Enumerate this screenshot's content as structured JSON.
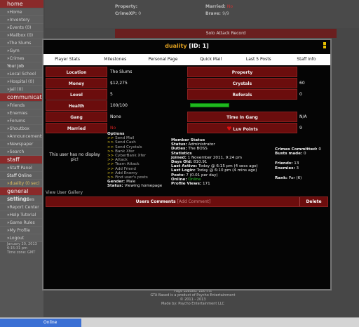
{
  "sidebar": {
    "sections": [
      {
        "head": "home",
        "items": [
          "»Home",
          "»Inventory",
          "»Events (0)",
          "»Mailbox (0)",
          "»The Slums",
          "»Gym",
          "»Crimes",
          "Your Job",
          "»Local School",
          "»Hospital (0)",
          "»Jail (0)"
        ]
      },
      {
        "head": "communicate",
        "items": [
          "»Friends",
          "»Enemies",
          "»Forums",
          "»Shoutbox",
          "»Announcements",
          "»Newspaper",
          "»Search"
        ]
      },
      {
        "head": "staff",
        "items": [
          "»Staff Panel",
          "Staff Online",
          "»duality (0 sec)"
        ]
      },
      {
        "head": "general settings",
        "items": [
          "»Preferences",
          "»Report Center",
          "»Help Tutorial",
          "»Game Rules",
          "»My Profile",
          "»Logout"
        ]
      }
    ],
    "footer": [
      "January 20, 2013",
      "6:15:31 pm",
      "Time zone: GMT"
    ]
  },
  "topinfo": {
    "property_label": "Property:",
    "married_label": "Married:",
    "married_value": "No",
    "crimexp_label": "CrimeXP:",
    "crimexp_value": "0",
    "brave_label": "Brave:",
    "brave_value": "9/9"
  },
  "solo_attack": "Solo Attack Record",
  "modal": {
    "username": "duality",
    "id_text": "[ID: 1]",
    "tabs": [
      "Player Stats",
      "Milestones",
      "Personal Page",
      "Quick Mail",
      "Last 5 Posts",
      "Staff Info"
    ],
    "stats": [
      {
        "l1": "Location",
        "v1": "The Slums",
        "l2": "Property",
        "v2": ""
      },
      {
        "l1": "Money",
        "v1": "$12,275",
        "l2": "Crystals",
        "v2": "60"
      },
      {
        "l1": "Level",
        "v1": "5",
        "l2": "Referals",
        "v2": "0"
      },
      {
        "l1": "Health",
        "v1": "100/100",
        "l2": "",
        "v2": ""
      },
      {
        "l1": "Gang",
        "v1": "None",
        "l2": "Time In Gang",
        "v2": "N/A"
      },
      {
        "l1": "Married",
        "v1": "No",
        "l2": "Luv Points",
        "v2": "9"
      }
    ],
    "health_pct": 1.0,
    "no_pic": "This user has no display pic!",
    "view_gallery": "View User Gallery",
    "options_head": "Options",
    "options": [
      "Send Mail",
      "Send Cash",
      "Send Crystals",
      "Bank Xfer",
      "CyberBank Xfer",
      "Attack",
      "Team Attack",
      "Add Friend",
      "Add Enemy",
      "Find user's posts"
    ],
    "gender_label": "Gender:",
    "gender": "Male",
    "status_label": "Status:",
    "status": "Viewing homepage",
    "member_status": [
      {
        "t": "Member Status",
        "h": true
      },
      {
        "k": "Status:",
        "v": "Administrator"
      },
      {
        "k": "Duties:",
        "v": "The BOSS"
      },
      {
        "t": "Statistics",
        "h": true
      },
      {
        "k": "Joined:",
        "v": "1 November 2011, 9:24 pm"
      },
      {
        "k": "Days Old:",
        "v": "810.91"
      },
      {
        "k": "Last Active:",
        "v": "Today @ 6:15 pm (4 secs ago)"
      },
      {
        "k": "Last Login:",
        "v": "Today @ 6:10 pm (4 mins ago)"
      },
      {
        "k": "Posts:",
        "v": "7 (0.01 per day)"
      },
      {
        "k": "Online:",
        "v": "Online",
        "on": true
      },
      {
        "k": "Profile Views:",
        "v": "171"
      }
    ],
    "crimes": {
      "committed_label": "Crimes Committed:",
      "committed": "0",
      "busts_label": "Busts made:",
      "busts": "0",
      "friends_label": "Friends:",
      "friends": "13",
      "enemies_label": "Enemies:",
      "enemies": "3",
      "rank_label": "Rank:",
      "rank": "Par (6)"
    },
    "comments_label": "Users Comments",
    "add_comment": "[Add Comment]",
    "delete_label": "Delete"
  },
  "bottom": [
    "Page Loaded: 186 ms",
    "GTA Based is a product of Psycho Entertainment",
    "© 2011 - 2013",
    "Made by: Psycho Entertainment LLC"
  ],
  "taskbar": {
    "online": "Online"
  },
  "colors": {
    "accent_red": "#6b0d0d",
    "health_green": "#1fb81f",
    "username_gold": "#e0a020"
  }
}
